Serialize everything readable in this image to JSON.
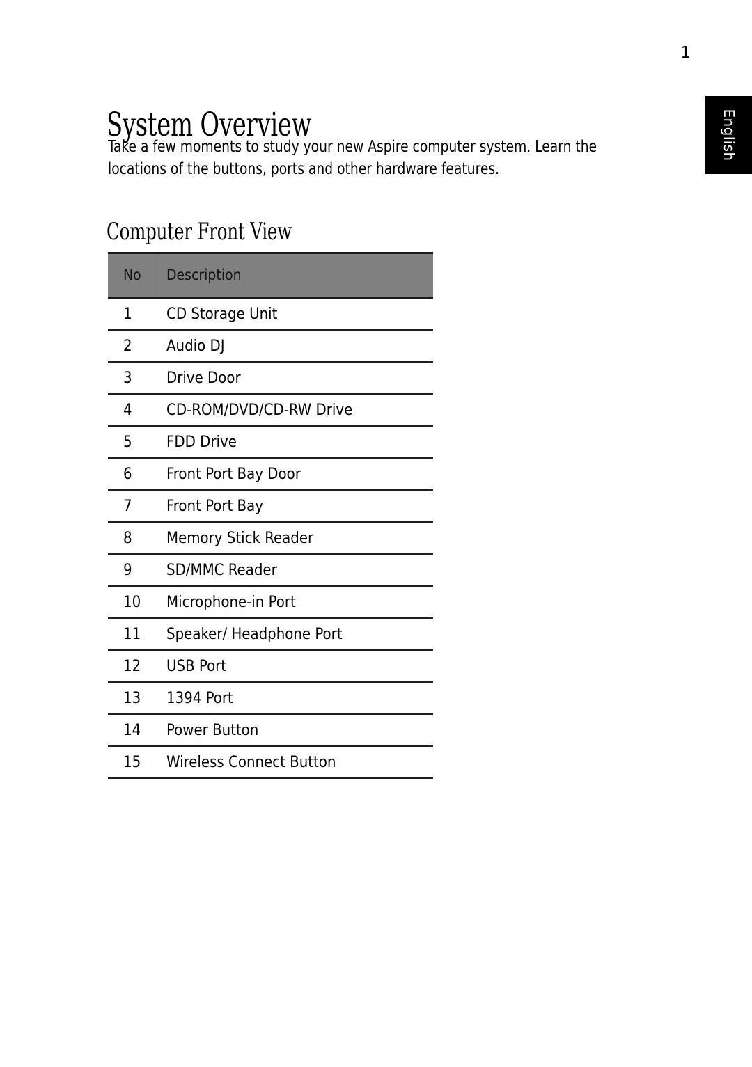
{
  "document": {
    "page_number": "1",
    "language_tab": "English",
    "heading": "System Overview",
    "intro_line_1": "Take a few moments to study your new Aspire computer system. Learn the",
    "intro_line_2": "locations of the buttons, ports and other hardware features.",
    "subheading": "Computer Front View"
  },
  "colors": {
    "table_header_bg": "#808080",
    "table_rule": "#231f20",
    "tab_bg": "#000000",
    "tab_text": "#ffffff",
    "page_bg": "#ffffff",
    "text": "#000000"
  },
  "table": {
    "columns": [
      "No",
      "Description"
    ],
    "rows": [
      {
        "no": "1",
        "description": "CD Storage Unit"
      },
      {
        "no": "2",
        "description": "Audio DJ"
      },
      {
        "no": "3",
        "description": "Drive Door"
      },
      {
        "no": "4",
        "description": "CD-ROM/DVD/CD-RW Drive"
      },
      {
        "no": "5",
        "description": "FDD Drive"
      },
      {
        "no": "6",
        "description": "Front Port Bay Door"
      },
      {
        "no": "7",
        "description": "Front Port Bay"
      },
      {
        "no": "8",
        "description": "Memory Stick Reader"
      },
      {
        "no": "9",
        "description": "SD/MMC Reader"
      },
      {
        "no": "10",
        "description": "Microphone-in Port"
      },
      {
        "no": "11",
        "description": "Speaker/ Headphone Port"
      },
      {
        "no": "12",
        "description": "USB Port"
      },
      {
        "no": "13",
        "description": "1394 Port"
      },
      {
        "no": "14",
        "description": "Power Button"
      },
      {
        "no": "15",
        "description": "Wireless Connect Button"
      }
    ]
  }
}
